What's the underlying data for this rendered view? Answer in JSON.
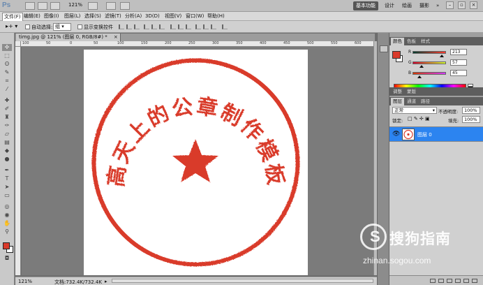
{
  "app": {
    "logo": "Ps",
    "zoom": "121%",
    "workspaces": [
      "基本功能",
      "设计",
      "绘画",
      "摄影"
    ],
    "active_workspace": "基本功能",
    "more": "»"
  },
  "menubar": {
    "items": [
      "文件(F)",
      "编辑(E)",
      "图像(I)",
      "图层(L)",
      "选择(S)",
      "滤镜(T)",
      "分析(A)",
      "3D(D)",
      "视图(V)",
      "窗口(W)",
      "帮助(H)"
    ]
  },
  "options": {
    "auto_select_label": "自动选择:",
    "auto_select_value": "组",
    "show_transform_label": "显示变换控件"
  },
  "document": {
    "tab_title": "timg.jpg @ 121% (图层 0, RGB/8#) *",
    "ruler_ticks": [
      "100",
      "50",
      "0",
      "50",
      "100",
      "150",
      "200",
      "250",
      "300",
      "350",
      "400",
      "450",
      "500",
      "550",
      "600"
    ],
    "seal_text": "高天上的公章制作模板",
    "seal_color": "#d93a2b"
  },
  "status": {
    "zoom": "121%",
    "doc_info": "文档:732.4K/732.4K"
  },
  "color_panel": {
    "tabs": [
      "颜色",
      "色板",
      "样式"
    ],
    "channels": [
      {
        "label": "R",
        "value": "213"
      },
      {
        "label": "G",
        "value": "57"
      },
      {
        "label": "B",
        "value": "45"
      }
    ]
  },
  "adjust_tabs": [
    "调整",
    "蒙版"
  ],
  "layers_panel": {
    "tabs": [
      "图层",
      "通道",
      "路径"
    ],
    "blend_mode": "正常",
    "opacity_label": "不透明度:",
    "opacity_value": "100%",
    "lock_label": "锁定:",
    "fill_label": "填充:",
    "fill_value": "100%",
    "layer_name": "图层 0",
    "layer_highlight": "#2c84f0"
  },
  "watermark": {
    "brand": "搜狗指南",
    "logo_letter": "S",
    "url": "zhinan.sogou.com"
  }
}
